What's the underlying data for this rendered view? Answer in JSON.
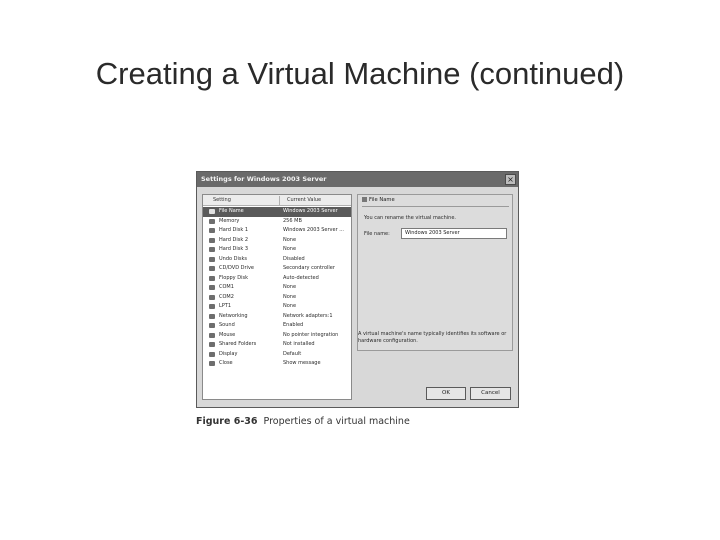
{
  "slide": {
    "title": "Creating a Virtual Machine (continued)"
  },
  "dialog": {
    "title": "Settings for Windows 2003 Server",
    "close_glyph": "×",
    "list": {
      "header_setting": "Setting",
      "header_value": "Current Value",
      "rows": [
        {
          "label": "File Name",
          "value": "Windows 2003 Server",
          "icon": "document-icon",
          "selected": true
        },
        {
          "label": "Memory",
          "value": "256 MB",
          "icon": "memory-icon"
        },
        {
          "label": "Hard Disk 1",
          "value": "Windows 2003 Server ...",
          "icon": "hard-disk-icon"
        },
        {
          "label": "Hard Disk 2",
          "value": "None",
          "icon": "hard-disk-icon"
        },
        {
          "label": "Hard Disk 3",
          "value": "None",
          "icon": "hard-disk-icon"
        },
        {
          "label": "Undo Disks",
          "value": "Disabled",
          "icon": "undo-disk-icon"
        },
        {
          "label": "CD/DVD Drive",
          "value": "Secondary controller",
          "icon": "cd-drive-icon"
        },
        {
          "label": "Floppy Disk",
          "value": "Auto-detected",
          "icon": "floppy-icon"
        },
        {
          "label": "COM1",
          "value": "None",
          "icon": "serial-port-icon"
        },
        {
          "label": "COM2",
          "value": "None",
          "icon": "serial-port-icon"
        },
        {
          "label": "LPT1",
          "value": "None",
          "icon": "parallel-port-icon"
        },
        {
          "label": "Networking",
          "value": "Network adapters:1",
          "icon": "network-icon"
        },
        {
          "label": "Sound",
          "value": "Enabled",
          "icon": "sound-icon"
        },
        {
          "label": "Mouse",
          "value": "No pointer integration",
          "icon": "mouse-icon"
        },
        {
          "label": "Shared Folders",
          "value": "Not installed",
          "icon": "folder-icon"
        },
        {
          "label": "Display",
          "value": "Default",
          "icon": "display-icon"
        },
        {
          "label": "Close",
          "value": "Show message",
          "icon": "close-setting-icon"
        }
      ]
    },
    "file_name_group": {
      "title": "File Name",
      "rename_text": "You can rename the virtual machine.",
      "file_label": "File name:",
      "file_value": "Windows 2003 Server"
    },
    "description": "A virtual machine's name typically identifies its software or hardware configuration.",
    "ok_label": "OK",
    "cancel_label": "Cancel"
  },
  "caption": {
    "figure_number": "Figure 6-36",
    "text": "Properties of a virtual machine"
  }
}
